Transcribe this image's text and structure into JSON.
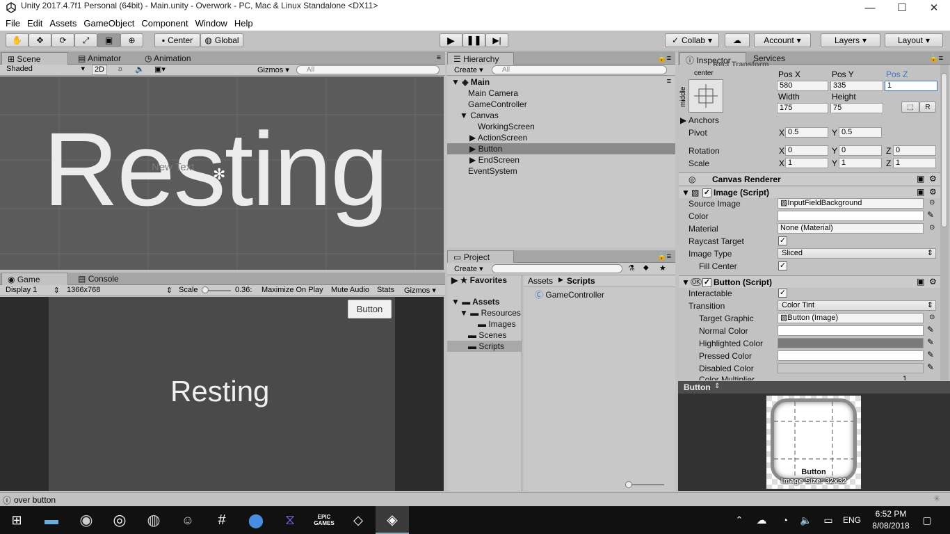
{
  "window": {
    "title": "Unity 2017.4.7f1 Personal (64bit) - Main.unity - Overwork - PC, Mac & Linux Standalone <DX11>",
    "minimize": "—",
    "maximize": "☐",
    "close": "✕"
  },
  "menu": [
    "File",
    "Edit",
    "Assets",
    "GameObject",
    "Component",
    "Window",
    "Help"
  ],
  "toolbar": {
    "center": "Center",
    "global": "Global",
    "collab": "Collab",
    "account": "Account",
    "layers": "Layers",
    "layout": "Layout"
  },
  "scene": {
    "tabs": [
      "Scene",
      "Animator",
      "Animation"
    ],
    "shaded": "Shaded",
    "mode2d": "2D",
    "gizmos": "Gizmos",
    "search_placeholder": "All",
    "big_text": "Resting",
    "new_text": "New Text"
  },
  "game": {
    "tabs": [
      "Game",
      "Console"
    ],
    "display": "Display 1",
    "resolution": "1366x768",
    "scale_label": "Scale",
    "scale_value": "0.36:",
    "maximize": "Maximize On Play",
    "mute": "Mute Audio",
    "stats": "Stats",
    "gizmos": "Gizmos",
    "button": "Button",
    "text": "Resting"
  },
  "hierarchy": {
    "tab": "Hierarchy",
    "create": "Create",
    "search_placeholder": "All",
    "scene": "Main",
    "items": [
      "Main Camera",
      "GameController",
      "Canvas",
      "WorkingScreen",
      "ActionScreen",
      "Button",
      "EndScreen",
      "EventSystem"
    ]
  },
  "project": {
    "tab": "Project",
    "create": "Create",
    "favorites": "Favorites",
    "assets": "Assets",
    "tree": [
      "Resources",
      "Images",
      "Scenes",
      "Scripts"
    ],
    "breadcrumb": [
      "Assets",
      "Scripts"
    ],
    "files": [
      "GameController"
    ]
  },
  "inspector": {
    "tabs": [
      "Inspector",
      "Services"
    ],
    "rect_header": "Rect Transform",
    "center": "center",
    "middle": "middle",
    "pos_labels": [
      "Pos X",
      "Pos Y",
      "Pos Z"
    ],
    "pos": [
      "580",
      "335",
      "1"
    ],
    "size_labels": [
      "Width",
      "Height"
    ],
    "size": [
      "175",
      "75"
    ],
    "anchors": "Anchors",
    "pivot": "Pivot",
    "pivot_vals": [
      "0.5",
      "0.5"
    ],
    "rotation": "Rotation",
    "rotation_vals": [
      "0",
      "0",
      "0"
    ],
    "scale": "Scale",
    "scale_vals": [
      "1",
      "1",
      "1"
    ],
    "x": "X",
    "y": "Y",
    "z": "Z",
    "r": "R",
    "canvas_renderer": "Canvas Renderer",
    "image_script": "Image (Script)",
    "image_rows": [
      {
        "label": "Source Image",
        "value": "InputFieldBackground"
      },
      {
        "label": "Color",
        "value": ""
      },
      {
        "label": "Material",
        "value": "None (Material)"
      },
      {
        "label": "Raycast Target",
        "value": ""
      },
      {
        "label": "Image Type",
        "value": "Sliced"
      },
      {
        "label": "Fill Center",
        "value": ""
      }
    ],
    "button_script": "Button (Script)",
    "ok": "OK",
    "button_rows": [
      {
        "label": "Interactable",
        "value": ""
      },
      {
        "label": "Transition",
        "value": "Color Tint"
      },
      {
        "label": "Target Graphic",
        "value": "Button (Image)"
      },
      {
        "label": "Normal Color",
        "value": ""
      },
      {
        "label": "Highlighted Color",
        "value": ""
      },
      {
        "label": "Pressed Color",
        "value": ""
      },
      {
        "label": "Disabled Color",
        "value": ""
      },
      {
        "label": "Color Multiplier",
        "value": "1"
      }
    ],
    "preview_title": "Button",
    "preview_name": "Button",
    "preview_size": "Image Size: 32x32"
  },
  "status": {
    "text": "over button"
  },
  "taskbar": {
    "lang": "ENG",
    "time": "6:52 PM",
    "date": "8/08/2018",
    "epic": "EPIC GAMES"
  },
  "colors": {
    "scene_bg": "#5b5b5b",
    "game_bg": "#4a4a4a",
    "accent": "#3f78c0",
    "selected": "#8a8a8a"
  }
}
